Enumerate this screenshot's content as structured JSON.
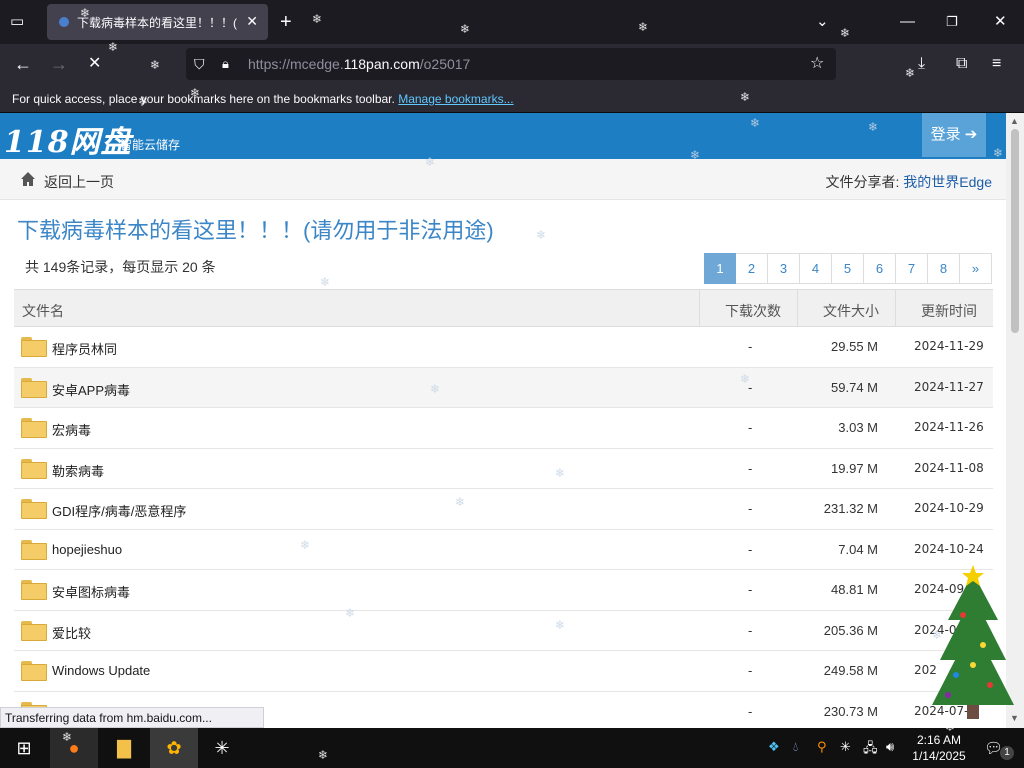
{
  "browser": {
    "tab_title": "下载病毒样本的看这里！！！(请",
    "url_prefix": "https://mcedge.",
    "url_domain": "118pan.com",
    "url_path": "/o25017",
    "bookmarks_hint": "For quick access, place your bookmarks here on the bookmarks toolbar.",
    "bookmarks_link": "Manage bookmarks...",
    "status": "Transferring data from hm.baidu.com..."
  },
  "site": {
    "logo": "118网盘",
    "logo_sub": "智能云储存",
    "login": "登录"
  },
  "subheader": {
    "back": "返回上一页",
    "sharer_label": "文件分享者: ",
    "sharer_name": "我的世界Edge"
  },
  "main": {
    "title": "下载病毒样本的看这里！！！(请勿用于非法用途)",
    "record_info": "共 149条记录，每页显示 20 条"
  },
  "pager": [
    "1",
    "2",
    "3",
    "4",
    "5",
    "6",
    "7",
    "8",
    "»"
  ],
  "table": {
    "headers": {
      "name": "文件名",
      "downloads": "下载次数",
      "size": "文件大小",
      "updated": "更新时间"
    },
    "rows": [
      {
        "name": "程序员林同",
        "downloads": "-",
        "size": "29.55 M",
        "date": "2024-11-29"
      },
      {
        "name": "安卓APP病毒",
        "downloads": "-",
        "size": "59.74 M",
        "date": "2024-11-27"
      },
      {
        "name": "宏病毒",
        "downloads": "-",
        "size": "3.03 M",
        "date": "2024-11-26"
      },
      {
        "name": "勒索病毒",
        "downloads": "-",
        "size": "19.97 M",
        "date": "2024-11-08"
      },
      {
        "name": "GDI程序/病毒/恶意程序",
        "downloads": "-",
        "size": "231.32 M",
        "date": "2024-10-29"
      },
      {
        "name": "hopejieshuo",
        "downloads": "-",
        "size": "7.04 M",
        "date": "2024-10-24"
      },
      {
        "name": "安卓图标病毒",
        "downloads": "-",
        "size": "48.81 M",
        "date": "2024-09-2"
      },
      {
        "name": "爱比较",
        "downloads": "-",
        "size": "205.36 M",
        "date": "2024-0"
      },
      {
        "name": "Windows Update",
        "downloads": "-",
        "size": "249.58 M",
        "date": "202"
      },
      {
        "name": "",
        "downloads": "-",
        "size": "230.73 M",
        "date": "2024-07-"
      }
    ]
  },
  "taskbar": {
    "time": "2:16 AM",
    "date": "1/14/2025",
    "notification_count": "1"
  },
  "colors": {
    "header_blue": "#1d7ec4",
    "title_blue": "#3b86c7",
    "firefox_dark": "#1c1b22"
  }
}
